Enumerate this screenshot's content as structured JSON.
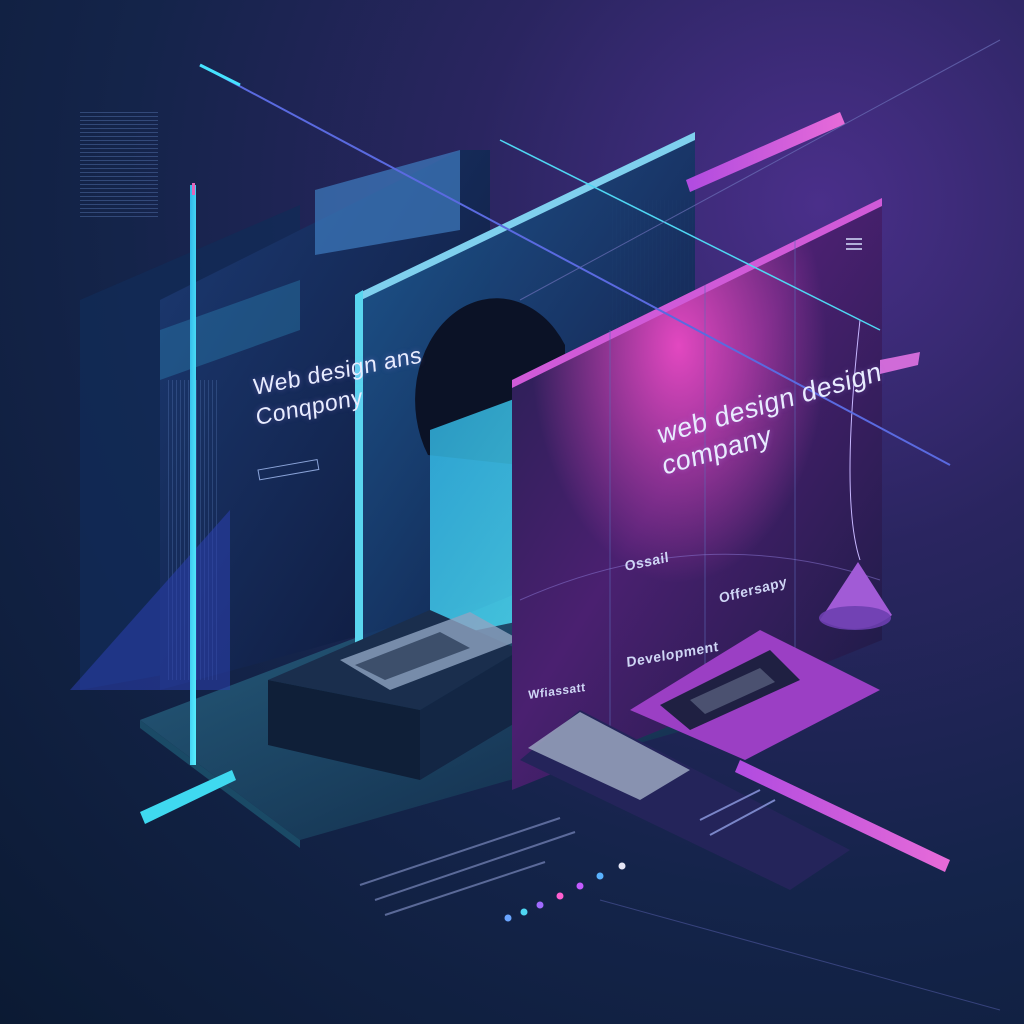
{
  "left_panel": {
    "heading_line1": "Web design ans",
    "heading_line2": "Conqpony"
  },
  "right_panel": {
    "heading_line1": "web design design",
    "heading_line2": "company",
    "label_1": "Ossail",
    "label_2": "Offersapy",
    "label_3": "Development",
    "label_4": "Wfiassatt"
  },
  "colors": {
    "accent_magenta": "#c64bd9",
    "accent_cyan": "#3fd9f0",
    "bg_dark": "#0b1a33"
  }
}
